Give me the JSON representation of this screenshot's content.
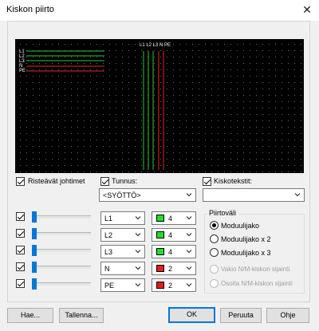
{
  "window": {
    "title": "Kiskon piirto"
  },
  "preview": {
    "top_header_label": "L1 L2 L3 N  PE",
    "left_labels": [
      "L1",
      "L2",
      "L3",
      "N",
      "PE"
    ],
    "colors": {
      "green": "#28c83c",
      "red": "#e02828",
      "grid_dot": "#6e6e6e"
    }
  },
  "options": {
    "crossing_wires": {
      "label": "Risteävät johtimet",
      "checked": true
    },
    "id": {
      "label": "Tunnus:",
      "checked": true,
      "value": "<SYÖTTÖ>"
    },
    "rail_texts": {
      "label": "Kiskotekstit:",
      "checked": true,
      "value": ""
    }
  },
  "conductors": [
    {
      "enabled": true,
      "slider": 0.0,
      "phase": "L1",
      "color_name": "green",
      "color": "#22e02a",
      "width": "4"
    },
    {
      "enabled": true,
      "slider": 0.0,
      "phase": "L2",
      "color_name": "green",
      "color": "#22e02a",
      "width": "4"
    },
    {
      "enabled": true,
      "slider": 0.0,
      "phase": "L3",
      "color_name": "green",
      "color": "#22e02a",
      "width": "4"
    },
    {
      "enabled": true,
      "slider": 0.0,
      "phase": "N",
      "color_name": "red",
      "color": "#e81c1c",
      "width": "2"
    },
    {
      "enabled": true,
      "slider": 0.0,
      "phase": "PE",
      "color_name": "red",
      "color": "#e81c1c",
      "width": "2"
    }
  ],
  "drawing_interval": {
    "title": "Piirtoväli",
    "options": [
      {
        "label": "Moduulijako",
        "checked": true,
        "disabled": false
      },
      {
        "label": "Moduulijako x 2",
        "checked": false,
        "disabled": false
      },
      {
        "label": "Moduulijako x 3",
        "checked": false,
        "disabled": false
      },
      {
        "label": "Vakio N/M-kiskon sijainti",
        "checked": false,
        "disabled": true
      },
      {
        "label": "Osoita N/M-kiskon sijainti",
        "checked": false,
        "disabled": true
      }
    ]
  },
  "buttons": {
    "fetch": "Hae...",
    "save": "Tallenna...",
    "ok": "OK",
    "cancel": "Peruuta",
    "help": "Ohje"
  }
}
